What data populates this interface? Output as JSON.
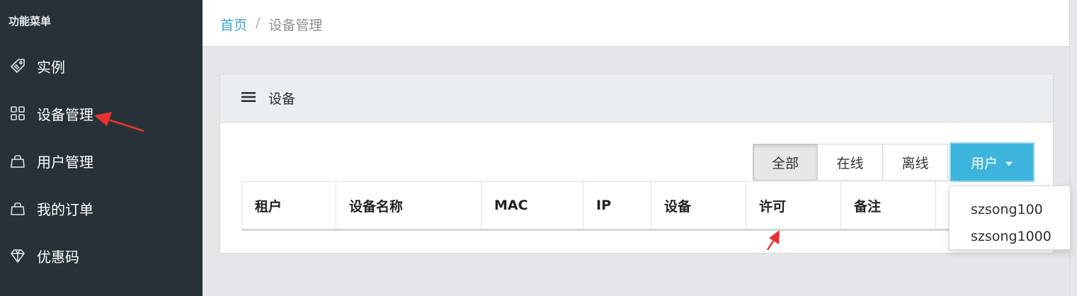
{
  "sidebar": {
    "title": "功能菜单",
    "items": [
      {
        "label": "实例",
        "icon": "tag-icon"
      },
      {
        "label": "设备管理",
        "icon": "grid-icon"
      },
      {
        "label": "用户管理",
        "icon": "bag-icon"
      },
      {
        "label": "我的订单",
        "icon": "bag-icon"
      },
      {
        "label": "优惠码",
        "icon": "diamond-icon"
      }
    ]
  },
  "breadcrumb": {
    "home": "首页",
    "separator": "/",
    "current": "设备管理"
  },
  "panel": {
    "title": "设备",
    "icon": "list-icon"
  },
  "filters": {
    "all": "全部",
    "online": "在线",
    "offline": "离线",
    "user": "用户",
    "active": "全部"
  },
  "table": {
    "headers": [
      "租户",
      "设备名称",
      "MAC",
      "IP",
      "设备",
      "许可",
      "备注"
    ]
  },
  "dropdown": {
    "options": [
      "szsong100",
      "szsong1000"
    ]
  },
  "colors": {
    "sidebar_bg": "#263238",
    "accent": "#3db4db",
    "link": "#3aa4cc",
    "annotation_arrow": "#e8322f"
  }
}
